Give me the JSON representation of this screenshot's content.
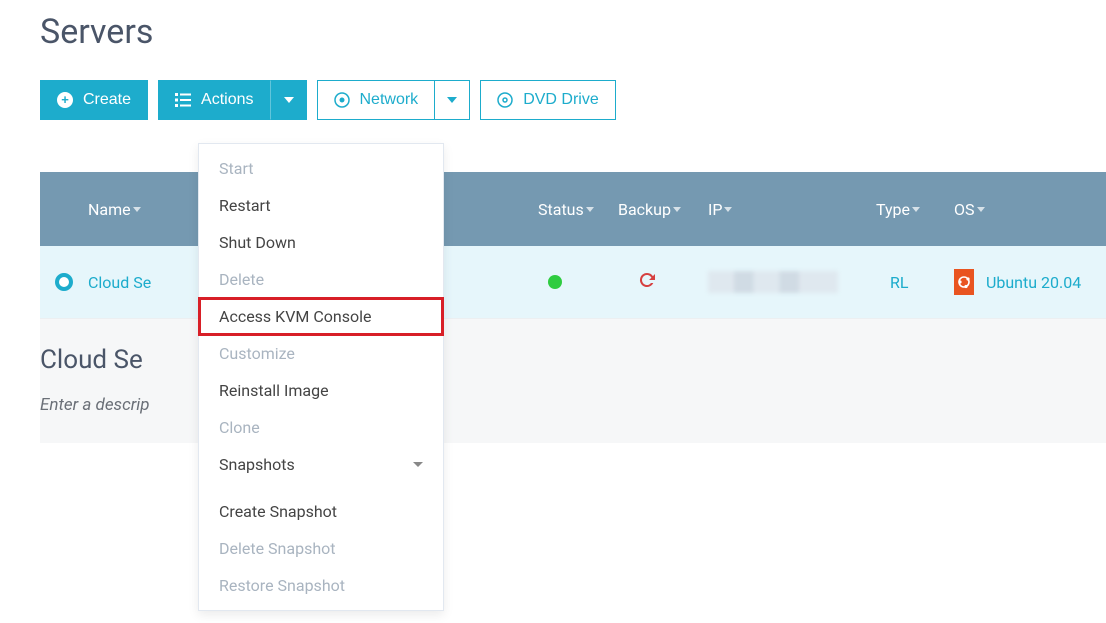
{
  "page": {
    "title": "Servers"
  },
  "toolbar": {
    "create": "Create",
    "actions": "Actions",
    "network": "Network",
    "dvd": "DVD Drive"
  },
  "dropdown": {
    "start": "Start",
    "restart": "Restart",
    "shutdown": "Shut Down",
    "delete": "Delete",
    "kvm": "Access KVM Console",
    "customize": "Customize",
    "reinstall": "Reinstall Image",
    "clone": "Clone",
    "snapshots": "Snapshots",
    "create_snap": "Create Snapshot",
    "delete_snap": "Delete Snapshot",
    "restore_snap": "Restore Snapshot"
  },
  "table": {
    "headers": {
      "name": "Name",
      "status": "Status",
      "backup": "Backup",
      "ip": "IP",
      "type": "Type",
      "os": "OS"
    },
    "row": {
      "name": "Cloud Se",
      "type": "RL",
      "os": "Ubuntu 20.04"
    }
  },
  "section": {
    "title": "Cloud Se",
    "desc": "Enter a descrip"
  }
}
